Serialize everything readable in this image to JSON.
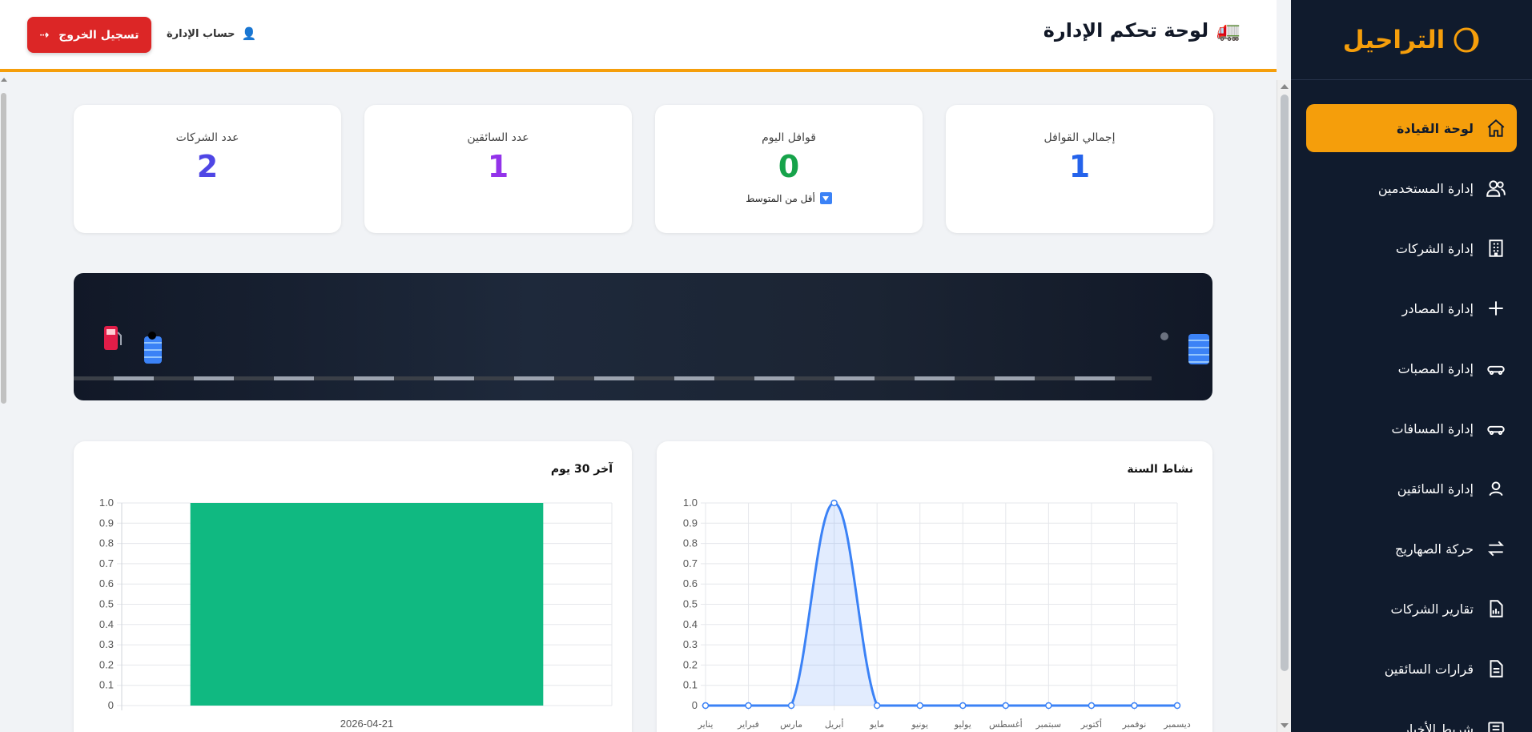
{
  "sidebar": {
    "brand": "التراحيل",
    "items": [
      {
        "label": "لوحة القيادة",
        "icon": "home-icon",
        "active": true
      },
      {
        "label": "إدارة المستخدمين",
        "icon": "users-icon"
      },
      {
        "label": "إدارة الشركات",
        "icon": "building-icon"
      },
      {
        "label": "إدارة المصادر",
        "icon": "plus-icon"
      },
      {
        "label": "إدارة المصبات",
        "icon": "tanker-icon"
      },
      {
        "label": "إدارة المسافات",
        "icon": "tanker-icon"
      },
      {
        "label": "إدارة السائقين",
        "icon": "user-icon"
      },
      {
        "label": "حركة الصهاريج",
        "icon": "swap-icon"
      },
      {
        "label": "تقارير الشركات",
        "icon": "report-chart-icon"
      },
      {
        "label": "قرارات السائقين",
        "icon": "document-icon"
      },
      {
        "label": "شريط الأخبار",
        "icon": "news-icon"
      }
    ]
  },
  "header": {
    "title": "لوحة تحكم الإدارة",
    "title_icon": "truck-icon",
    "account_label": "حساب الإدارة",
    "logout_label": "تسجيل الخروج"
  },
  "stats": [
    {
      "label": "إجمالي القوافل",
      "value": "1",
      "color": "#2563eb"
    },
    {
      "label": "قوافل اليوم",
      "value": "0",
      "color": "#16a34a",
      "note": "أقل من المتوسط"
    },
    {
      "label": "عدد السائقين",
      "value": "1",
      "color": "#9333ea"
    },
    {
      "label": "عدد الشركات",
      "value": "2",
      "color": "#4f46e5"
    }
  ],
  "chart_data": [
    {
      "type": "line",
      "title": "نشاط السنة",
      "categories": [
        "يناير",
        "فبراير",
        "مارس",
        "أبريل",
        "مايو",
        "يونيو",
        "يوليو",
        "أغسطس",
        "سبتمبر",
        "أكتوبر",
        "نوفمبر",
        "ديسمبر"
      ],
      "series": [
        {
          "values": [
            0,
            0,
            0,
            1,
            0,
            0,
            0,
            0,
            0,
            0,
            0,
            0
          ],
          "color": "#3b82f6"
        }
      ],
      "ylim": [
        0,
        1.0
      ],
      "yticks": [
        "1.0",
        "0.9",
        "0.8",
        "0.7",
        "0.6",
        "0.5",
        "0.4",
        "0.3",
        "0.2",
        "0.1",
        "0"
      ],
      "grid": true
    },
    {
      "type": "bar",
      "title": "آخر 30 يوم",
      "categories": [
        "2026-04-21"
      ],
      "values": [
        1
      ],
      "color": "#10b981",
      "ylim": [
        0,
        1.0
      ],
      "yticks": [
        "1.0",
        "0.9",
        "0.8",
        "0.7",
        "0.6",
        "0.5",
        "0.4",
        "0.3",
        "0.2",
        "0.1",
        "0"
      ],
      "grid": true
    }
  ]
}
